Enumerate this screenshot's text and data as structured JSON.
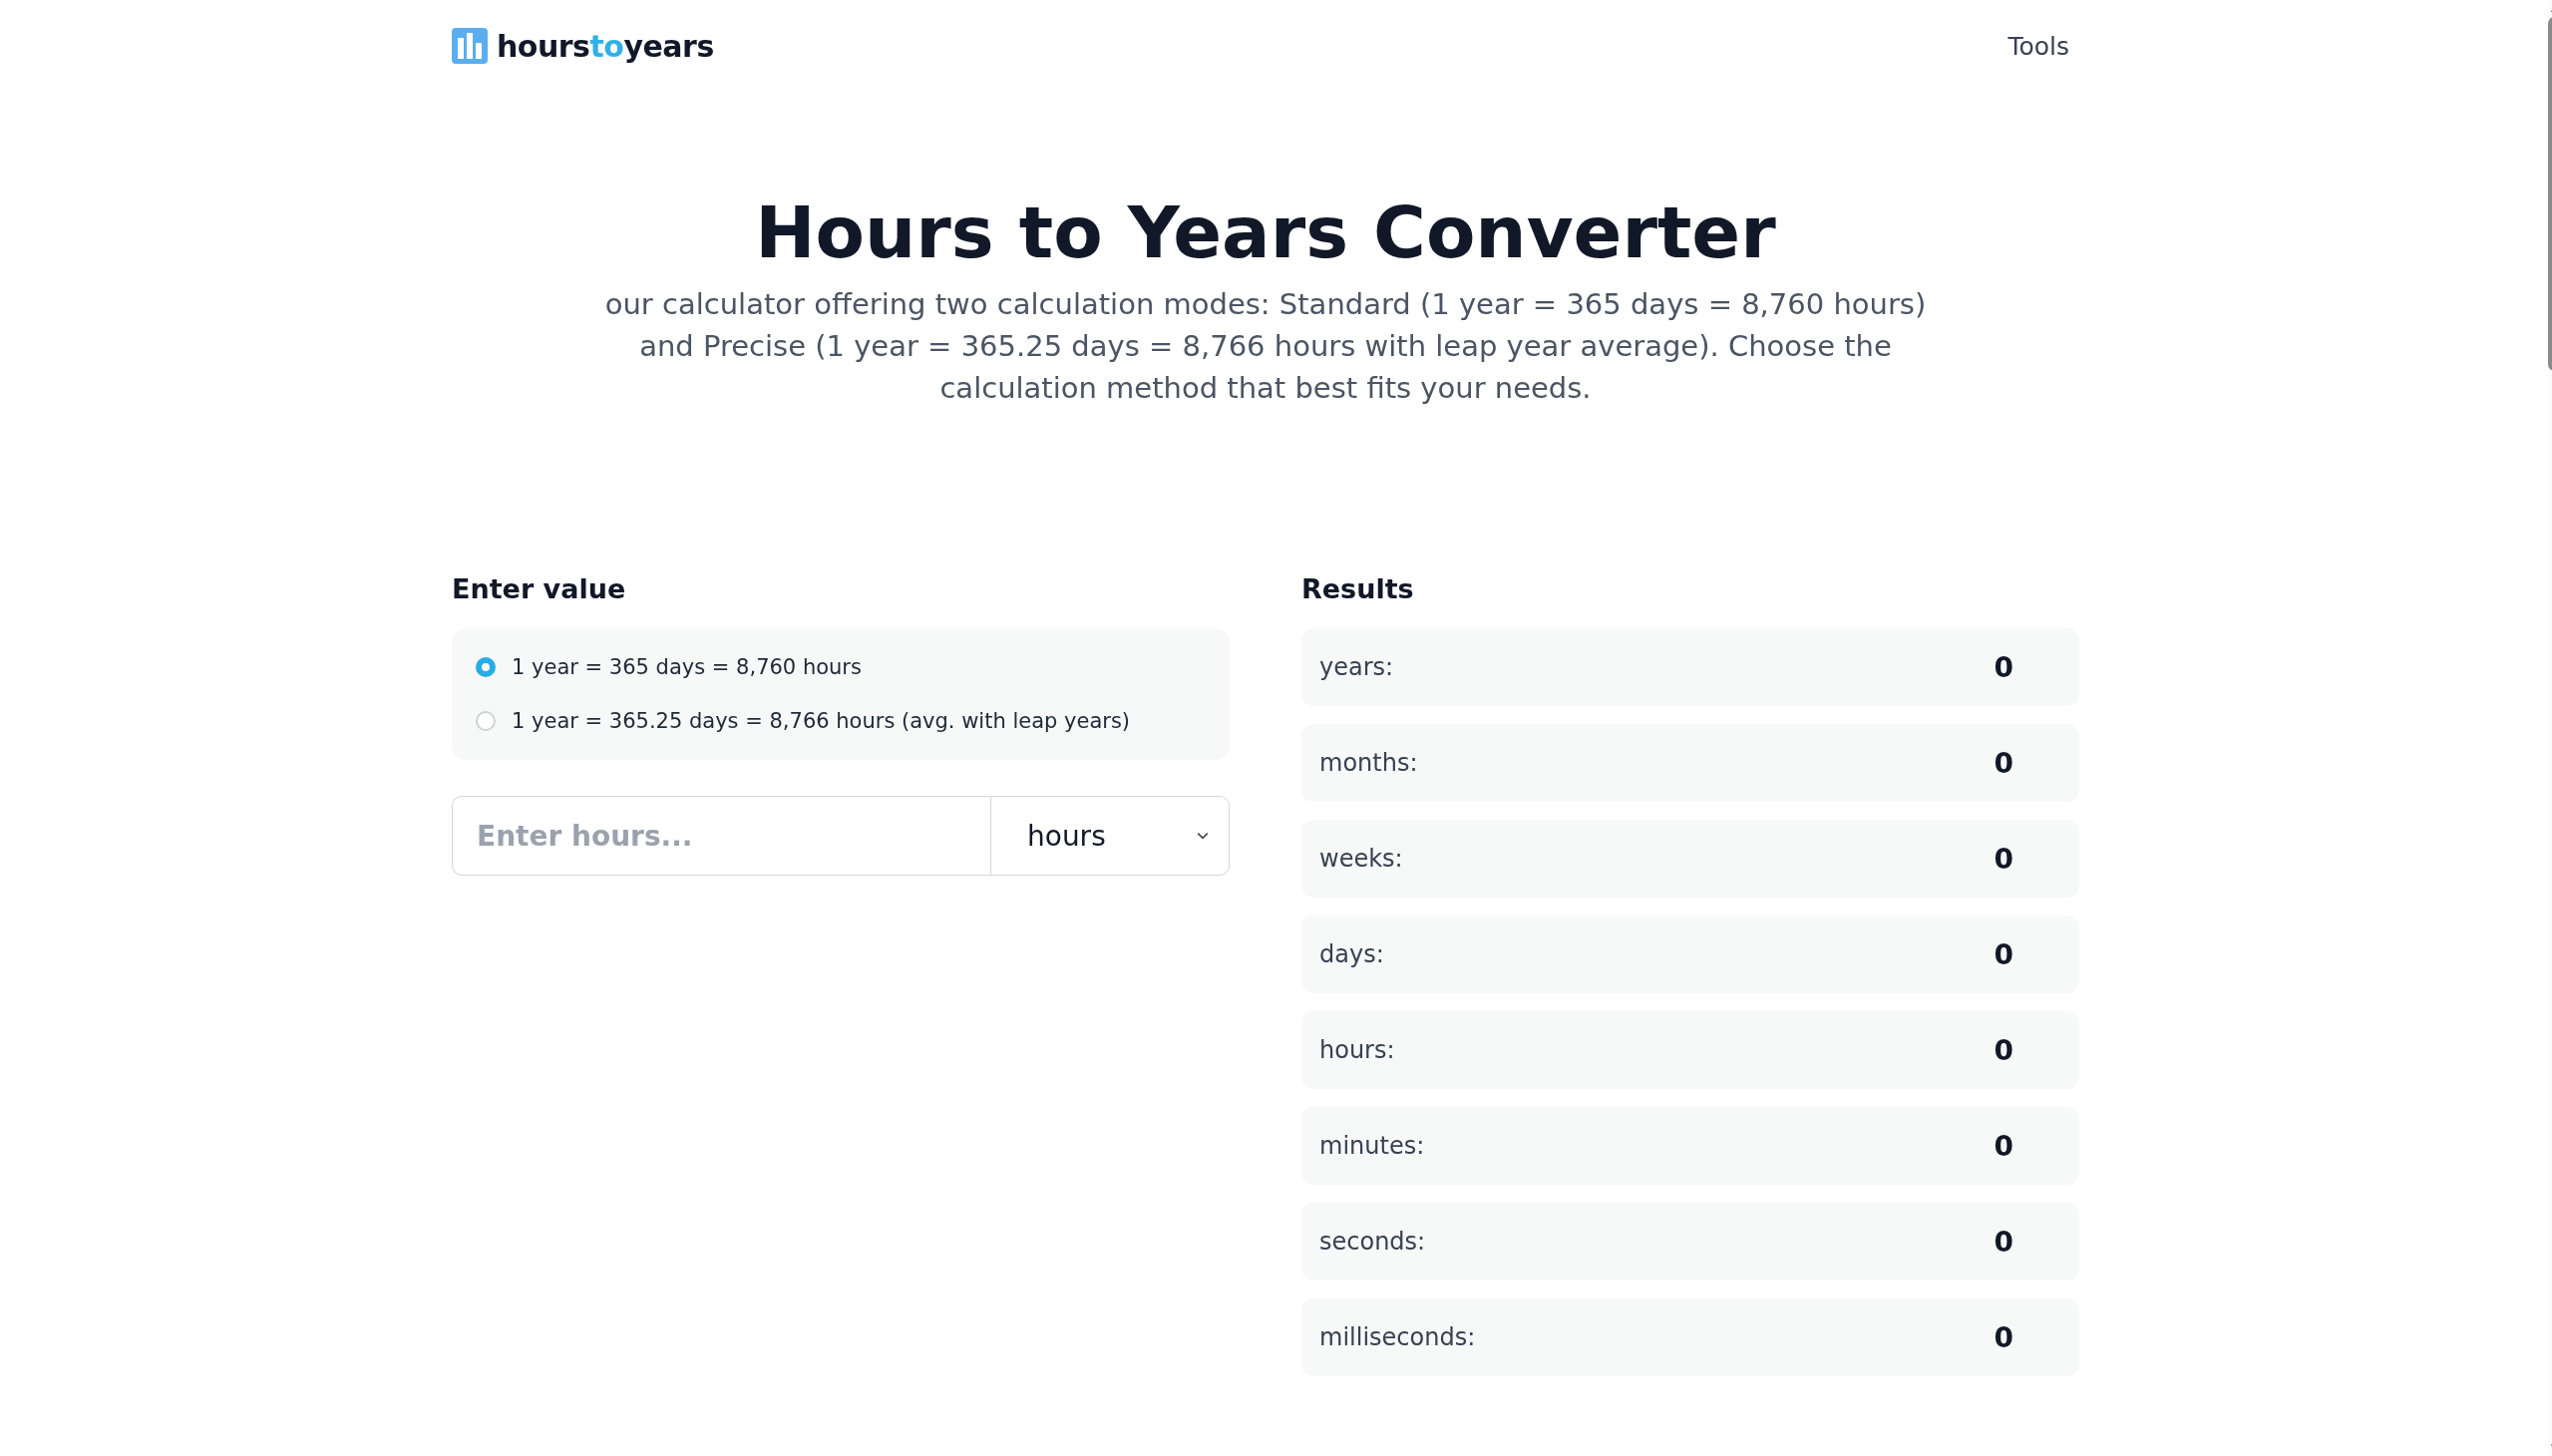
{
  "header": {
    "logo": [
      {
        "text": "hours",
        "highlight": false
      },
      {
        "text": "to",
        "highlight": true
      },
      {
        "text": "years",
        "highlight": false
      }
    ],
    "nav": [
      "Tools"
    ]
  },
  "hero": {
    "title": "Hours to Years Converter",
    "description": "our calculator offering two calculation modes: Standard (1 year = 365 days = 8,760 hours) and Precise (1 year = 365.25 days = 8,766 hours with leap year average). Choose the calculation method that best fits your needs."
  },
  "input_panel": {
    "heading": "Enter value",
    "modes": [
      {
        "label": "1 year = 365 days = 8,760 hours",
        "selected": true
      },
      {
        "label": "1 year = 365.25 days = 8,766 hours (avg. with leap years)",
        "selected": false
      }
    ],
    "field": {
      "placeholder": "Enter hours..."
    },
    "unit": {
      "value": "hours"
    }
  },
  "results": {
    "heading": "Results",
    "rows": [
      {
        "label": "years:",
        "value": "0"
      },
      {
        "label": "months:",
        "value": "0"
      },
      {
        "label": "weeks:",
        "value": "0"
      },
      {
        "label": "days:",
        "value": "0"
      },
      {
        "label": "hours:",
        "value": "0"
      },
      {
        "label": "minutes:",
        "value": "0"
      },
      {
        "label": "seconds:",
        "value": "0"
      },
      {
        "label": "milliseconds:",
        "value": "0"
      }
    ]
  }
}
